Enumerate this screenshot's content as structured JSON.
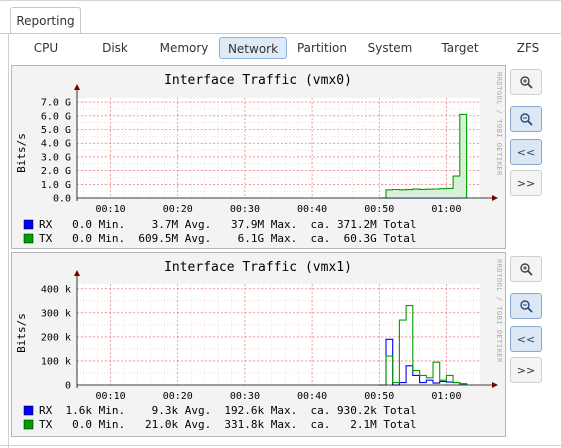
{
  "outer_tab": "Reporting",
  "tabs": [
    {
      "label": "CPU",
      "active": false
    },
    {
      "label": "Disk",
      "active": false
    },
    {
      "label": "Memory",
      "active": false
    },
    {
      "label": "Network",
      "active": true
    },
    {
      "label": "Partition",
      "active": false
    },
    {
      "label": "System",
      "active": false
    },
    {
      "label": "Target",
      "active": false
    },
    {
      "label": "ZFS",
      "active": false
    }
  ],
  "side_buttons": [
    {
      "icon": "zoom-in-icon",
      "label": "+"
    },
    {
      "icon": "zoom-out-icon",
      "label": "-"
    },
    {
      "icon": "back-icon",
      "label": "<<"
    },
    {
      "icon": "forward-icon",
      "label": ">>"
    }
  ],
  "colors": {
    "rx": "#0000ff",
    "tx": "#00a000",
    "grid": "#f2b8b8",
    "arrow": "#7a0000"
  },
  "watermark": "RRDTOOL / TOBI OETIKER",
  "chart_data": [
    {
      "type": "area",
      "title": "Interface Traffic (vmx0)",
      "ylabel": "Bits/s",
      "x_ticks": [
        "00:10",
        "00:20",
        "00:30",
        "00:40",
        "00:50",
        "01:00"
      ],
      "x_range": [
        "00:05",
        "01:05"
      ],
      "y_ticks": [
        "0.0",
        "1.0 G",
        "2.0 G",
        "3.0 G",
        "4.0 G",
        "5.0 G",
        "6.0 G",
        "7.0 G"
      ],
      "y_tick_values": [
        0,
        1,
        2,
        3,
        4,
        5,
        6,
        7
      ],
      "ylim": [
        0,
        7.3
      ],
      "y_unit": "G",
      "x": [
        "00:50",
        "00:51",
        "00:52",
        "00:53",
        "00:54",
        "00:55",
        "00:56",
        "00:57",
        "00:58",
        "00:59",
        "01:00",
        "01:01",
        "01:02",
        "01:03"
      ],
      "series": [
        {
          "name": "RX",
          "color": "#0000ff",
          "values": [
            0.0,
            0.005,
            0.004,
            0.004,
            0.003,
            0.004,
            0.004,
            0.004,
            0.004,
            0.005,
            0.006,
            0.008,
            0.02,
            0.0
          ]
        },
        {
          "name": "TX",
          "color": "#00a000",
          "values": [
            0.0,
            0.6,
            0.62,
            0.6,
            0.61,
            0.65,
            0.63,
            0.64,
            0.66,
            0.68,
            0.7,
            1.6,
            6.1,
            0.0
          ]
        }
      ],
      "legend": [
        {
          "name": "RX",
          "min": "0.0",
          "avg": "3.7M",
          "max": "37.9M",
          "total": "371.2M"
        },
        {
          "name": "TX",
          "min": "0.0",
          "avg": "609.5M",
          "max": "6.1G",
          "total": "60.3G"
        }
      ],
      "legend_words": {
        "min": "Min.",
        "avg": "Avg.",
        "max": "Max.",
        "ca": "ca.",
        "total": "Total"
      }
    },
    {
      "type": "line",
      "title": "Interface Traffic (vmx1)",
      "ylabel": "Bits/s",
      "x_ticks": [
        "00:10",
        "00:20",
        "00:30",
        "00:40",
        "00:50",
        "01:00"
      ],
      "x_range": [
        "00:05",
        "01:05"
      ],
      "y_ticks": [
        "0",
        "100 k",
        "200 k",
        "300 k",
        "400 k"
      ],
      "y_tick_values": [
        0,
        100,
        200,
        300,
        400
      ],
      "ylim": [
        0,
        420
      ],
      "y_unit": "k",
      "x": [
        "00:50",
        "00:51",
        "00:52",
        "00:53",
        "00:54",
        "00:55",
        "00:56",
        "00:57",
        "00:58",
        "00:59",
        "01:00",
        "01:01",
        "01:02",
        "01:03"
      ],
      "series": [
        {
          "name": "RX",
          "color": "#0000ff",
          "values": [
            0,
            190,
            0,
            10,
            80,
            40,
            10,
            20,
            8,
            15,
            12,
            10,
            5,
            0
          ]
        },
        {
          "name": "TX",
          "color": "#00a000",
          "values": [
            0,
            120,
            10,
            270,
            330,
            60,
            40,
            30,
            95,
            20,
            40,
            10,
            5,
            0
          ]
        }
      ],
      "legend": [
        {
          "name": "RX",
          "min": "1.6k",
          "avg": "9.3k",
          "max": "192.6k",
          "total": "930.2k"
        },
        {
          "name": "TX",
          "min": "0.0",
          "avg": "21.0k",
          "max": "331.8k",
          "total": "2.1M"
        }
      ],
      "legend_words": {
        "min": "Min.",
        "avg": "Avg.",
        "max": "Max.",
        "ca": "ca.",
        "total": "Total"
      }
    }
  ]
}
